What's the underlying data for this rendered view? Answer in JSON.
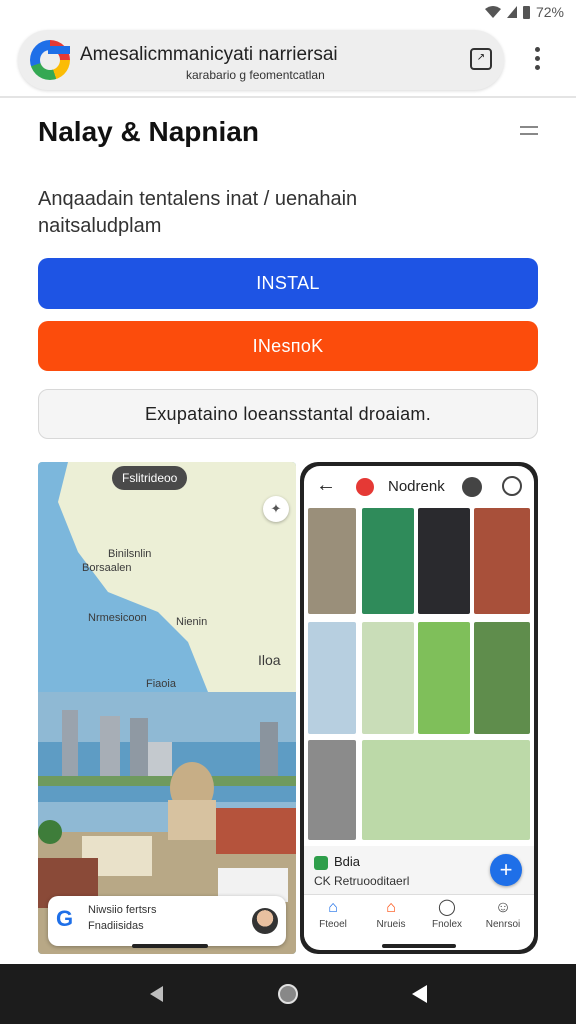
{
  "status_bar": {
    "battery_text": "72%"
  },
  "browser": {
    "url": "Amesalicmmanicyati narriersai",
    "url_sub": "karabario  g  feomentcatlan"
  },
  "page": {
    "title": "Nalay & Napnian",
    "description": "Anqaadain tentalens inat / uenahain naitsaludplam"
  },
  "buttons": {
    "install": "INSTAL",
    "orange": "INesпoK",
    "secondary": "Exupataino loeansstantal droaiam."
  },
  "screenshot_left": {
    "chip": "Fslitrideoo",
    "labels": [
      "Binilsnlin",
      "Borsaalen",
      "Nrmesicoon",
      "Nienin",
      "Iloa",
      "Fiaoia"
    ],
    "card_logo": "G",
    "card_title": "Niwsiio fertsrs",
    "card_sub": "Fnadiisidas"
  },
  "screenshot_right": {
    "title": "Nodrenk",
    "card_title": "Bdia",
    "card_sub": "CK  Retruooditaerl",
    "nav": [
      {
        "icon": "home-icon",
        "label": "Fteoel"
      },
      {
        "icon": "house-outline-icon",
        "label": "Nrueis"
      },
      {
        "icon": "chat-icon",
        "label": "Fnolex"
      },
      {
        "icon": "person-icon",
        "label": "Nenrsoi"
      }
    ]
  },
  "colors": {
    "install_blue": "#1e54e4",
    "orange": "#fc4c0c",
    "accent_blue": "#1e6fe8"
  }
}
